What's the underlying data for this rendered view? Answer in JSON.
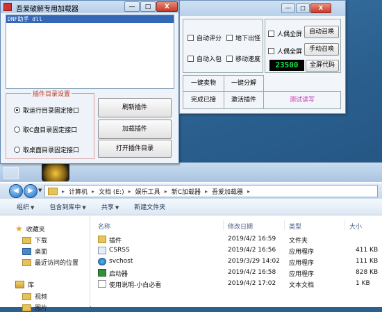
{
  "tool_window": {
    "title": "吾爱破解专用加载器",
    "minimize": "—",
    "maximize": "□",
    "close": "X",
    "log_line": "DNF助手 dll",
    "plugin_group": {
      "title": "插件目录设置",
      "options": [
        {
          "label": "取运行目录固定接口",
          "selected": true
        },
        {
          "label": "取C盘目录固定接口",
          "selected": false
        },
        {
          "label": "取桌面目录固定接口",
          "selected": false
        }
      ]
    },
    "buttons": {
      "refresh": "刷新插件",
      "load": "加载插件",
      "open_dir": "打开插件目录"
    }
  },
  "panel_window": {
    "minimize": "—",
    "maximize": "□",
    "close": "X",
    "checkboxes": [
      {
        "label": "自动评分",
        "checked": false
      },
      {
        "label": "地下出怪",
        "checked": false
      },
      {
        "label": "自动入包",
        "checked": false
      },
      {
        "label": "移动速度",
        "checked": false
      },
      {
        "label": "人偶全屏",
        "checked": false
      },
      {
        "label": "人偶全屏",
        "checked": false
      }
    ],
    "buttons": {
      "auto_summon": "自动召唤",
      "manual_summon": "手动召唤",
      "fullscreen_code": "全屏代码"
    },
    "counter": "23500",
    "grid": {
      "sell_all": "一键卖物",
      "split_all": "一键分解",
      "complete": "完成已接",
      "activate_plugin": "激活插件",
      "test_rw": "测试读写"
    }
  },
  "explorer": {
    "nav_back": "◀",
    "nav_forward": "▶",
    "breadcrumb": [
      "计算机",
      "文档 (E:)",
      "娱乐工具",
      "新C加载器",
      "吾爱加载器"
    ],
    "toolbar": {
      "organize": "组织",
      "include_in_library": "包含到库中",
      "share": "共享",
      "new_folder": "新建文件夹"
    },
    "nav_pane": {
      "favorites": "收藏夹",
      "downloads": "下载",
      "desktop": "桌面",
      "recent": "最近访问的位置",
      "libraries": "库",
      "videos": "视频",
      "pictures": "图片"
    },
    "columns": {
      "name": "名称",
      "modified": "修改日期",
      "type": "类型",
      "size": "大小"
    },
    "files": [
      {
        "name": "插件",
        "modified": "2019/4/2 16:59",
        "type": "文件夹",
        "size": "",
        "icon": "folder"
      },
      {
        "name": "CSRSS",
        "modified": "2019/4/2 16:56",
        "type": "应用程序",
        "size": "411 KB",
        "icon": "exe"
      },
      {
        "name": "svchost",
        "modified": "2019/3/29 14:02",
        "type": "应用程序",
        "size": "111 KB",
        "icon": "svc"
      },
      {
        "name": "启动器",
        "modified": "2019/4/2 16:58",
        "type": "应用程序",
        "size": "828 KB",
        "icon": "boot"
      },
      {
        "name": "使用说明-小白必看",
        "modified": "2019/4/2 17:02",
        "type": "文本文档",
        "size": "1 KB",
        "icon": "txt"
      }
    ]
  }
}
